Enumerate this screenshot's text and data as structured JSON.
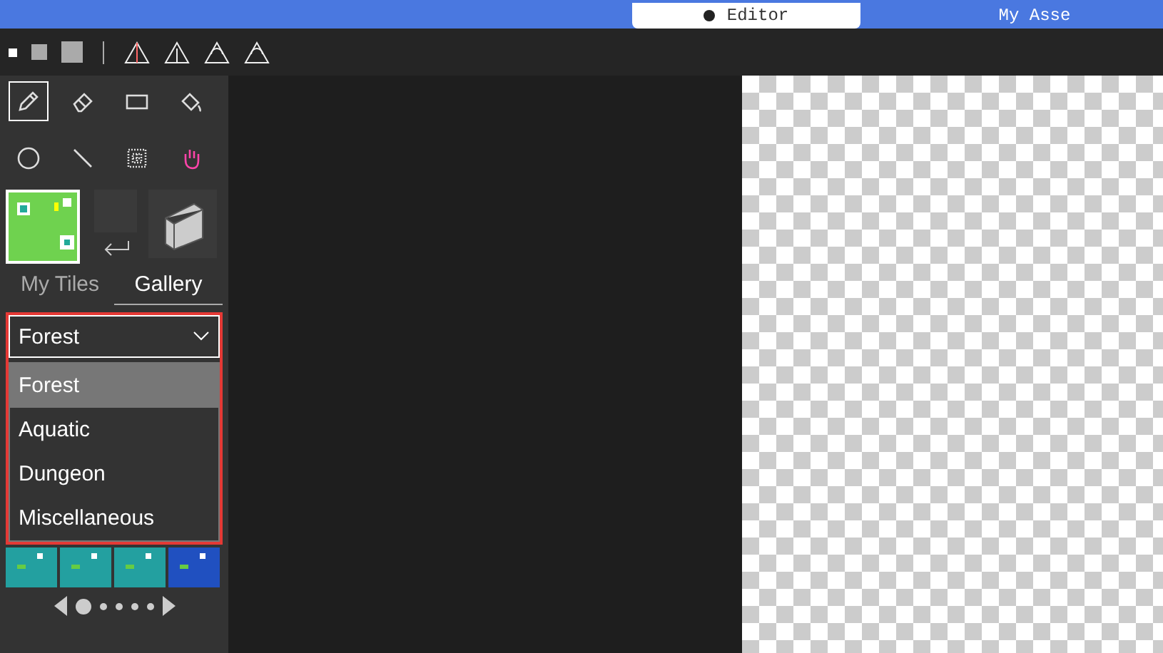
{
  "top_tabs": [
    {
      "label": "Editor",
      "selected": true
    },
    {
      "label": "My Asse",
      "selected": false
    }
  ],
  "brush_sizes": [
    {
      "selected": true
    },
    {
      "selected": false
    },
    {
      "selected": false
    }
  ],
  "tools": [
    {
      "kind": "pencil",
      "selected": true
    },
    {
      "kind": "eraser",
      "selected": false
    },
    {
      "kind": "rect",
      "selected": false
    },
    {
      "kind": "fill",
      "selected": false
    },
    {
      "kind": "circle",
      "selected": false
    },
    {
      "kind": "line",
      "selected": false
    },
    {
      "kind": "marquee",
      "selected": false
    },
    {
      "kind": "hand",
      "selected": false
    }
  ],
  "tile_tabs": [
    {
      "label": "My Tiles",
      "selected": false
    },
    {
      "label": "Gallery",
      "selected": true
    }
  ],
  "category_select": {
    "value": "Forest",
    "expanded": true,
    "options": [
      {
        "label": "Forest",
        "selected": true
      },
      {
        "label": "Aquatic",
        "selected": false
      },
      {
        "label": "Dungeon",
        "selected": false
      },
      {
        "label": "Miscellaneous",
        "selected": false
      }
    ]
  },
  "pager": [
    {
      "selected": true
    },
    {
      "selected": false
    },
    {
      "selected": false
    },
    {
      "selected": false
    },
    {
      "selected": false
    }
  ]
}
